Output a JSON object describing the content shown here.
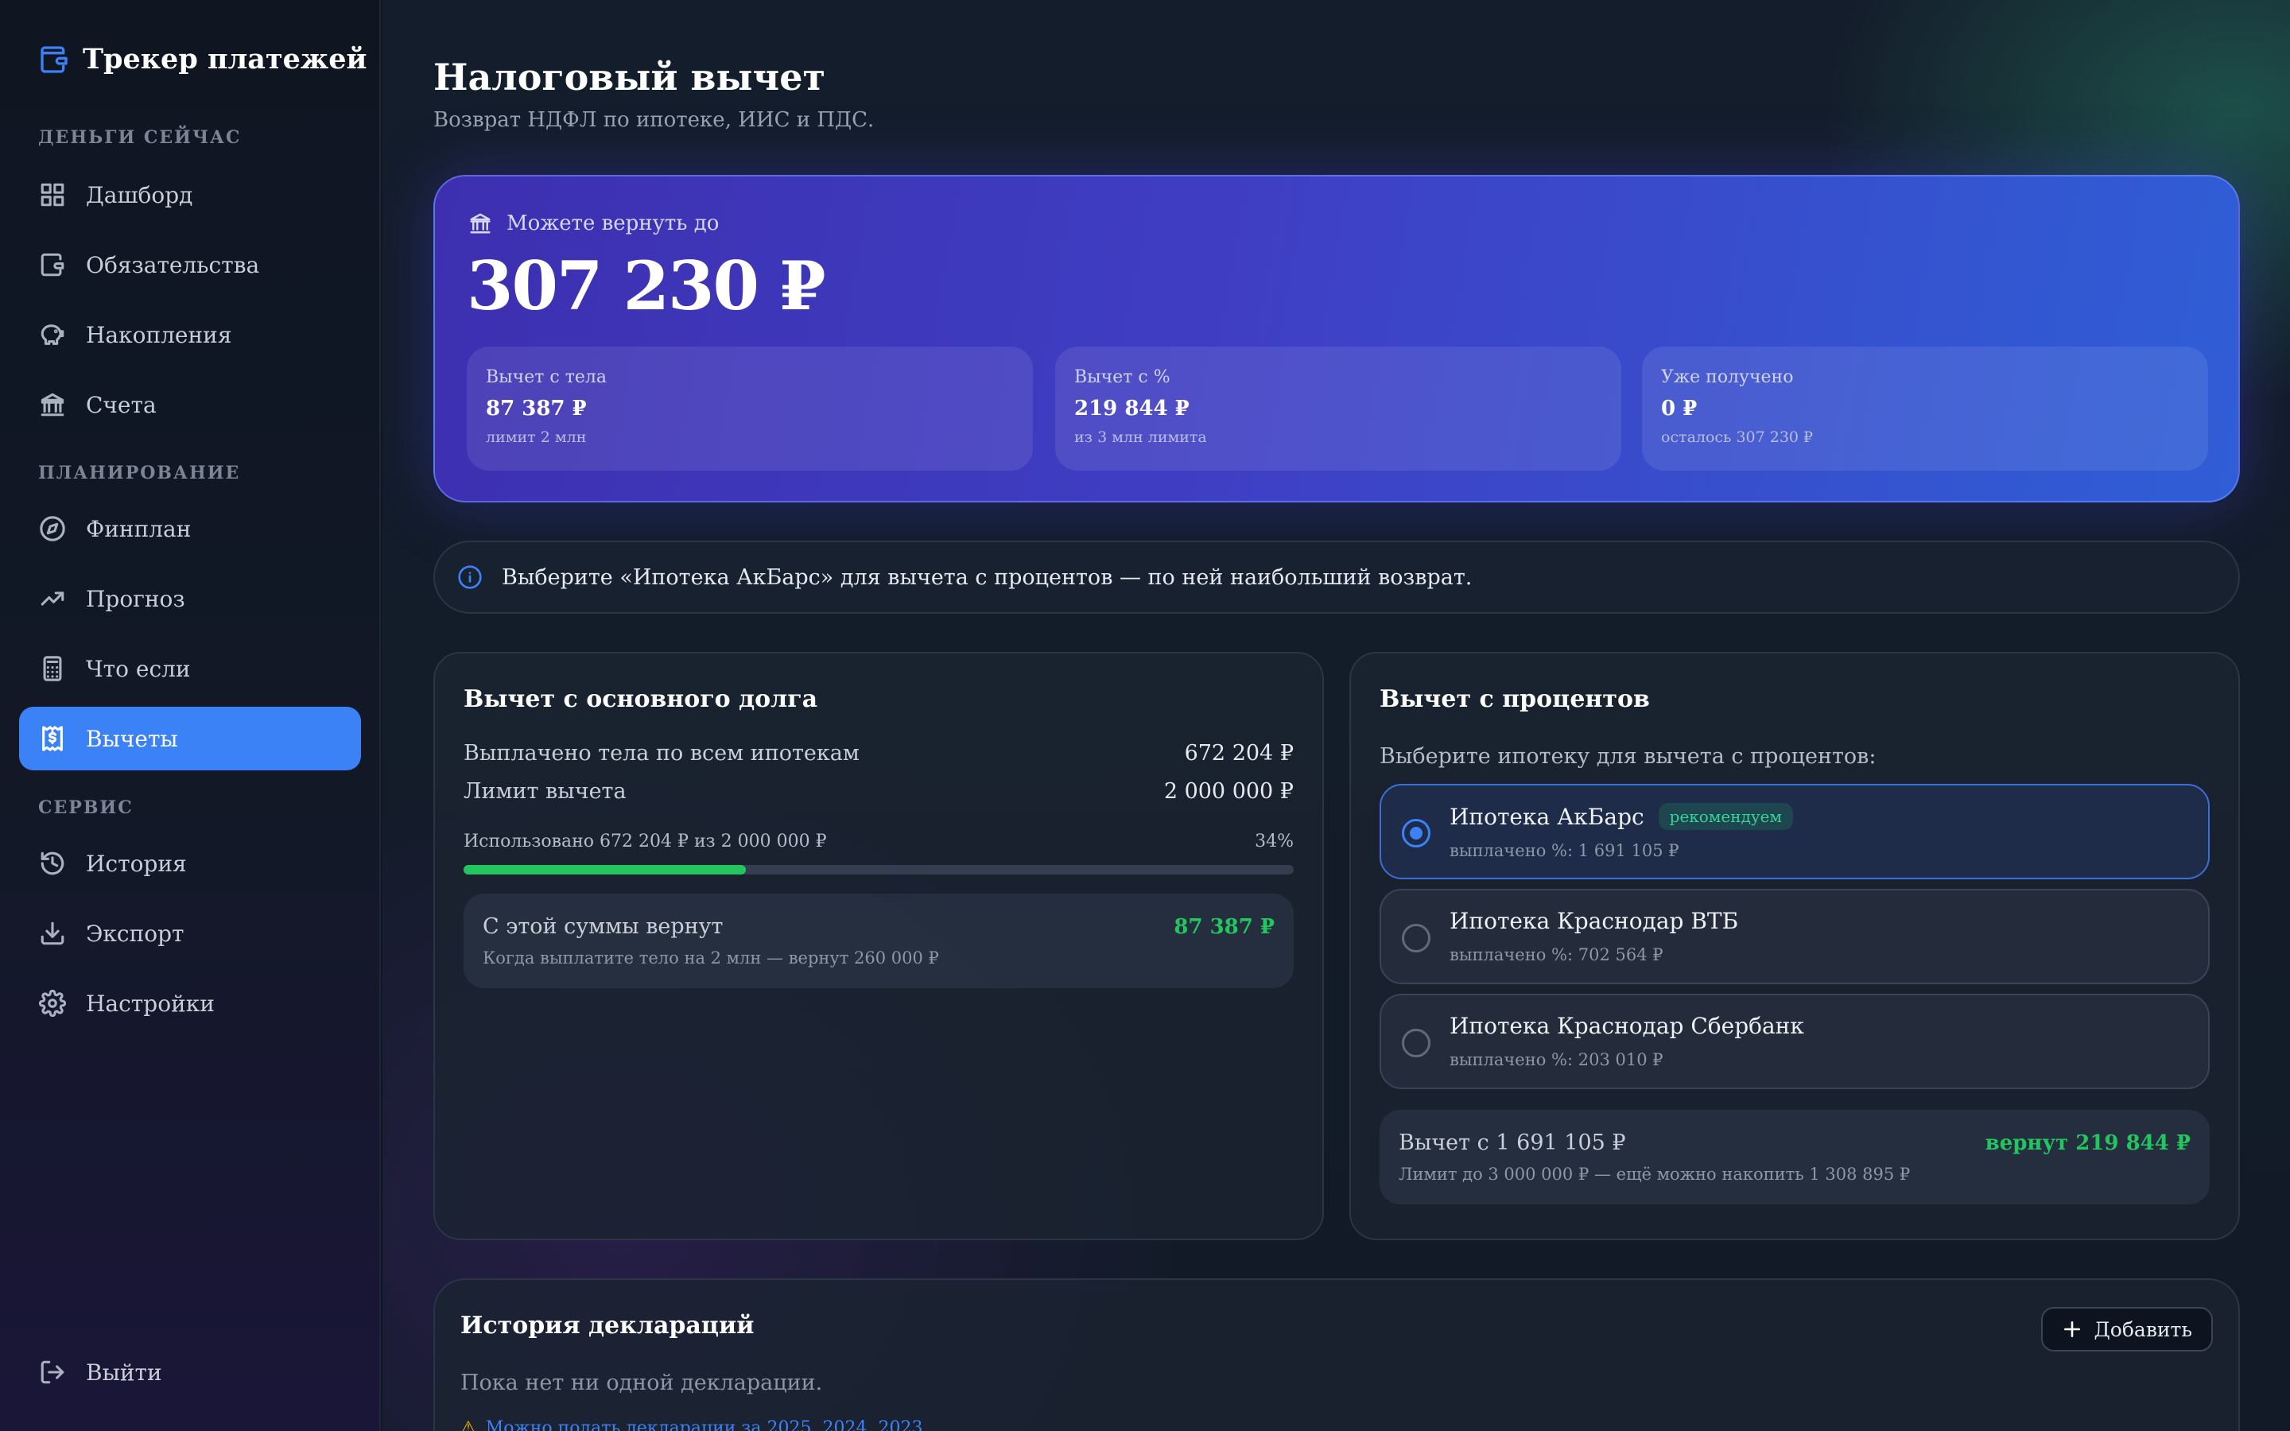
{
  "app": {
    "title": "Трекер платежей"
  },
  "sidebar": {
    "sections": [
      {
        "title": "ДЕНЬГИ СЕЙЧАС"
      },
      {
        "title": "ПЛАНИРОВАНИЕ"
      },
      {
        "title": "СЕРВИС"
      }
    ],
    "items": [
      {
        "label": "Дашборд",
        "icon": "dashboard-icon"
      },
      {
        "label": "Обязательства",
        "icon": "wallet-icon"
      },
      {
        "label": "Накопления",
        "icon": "piggy-bank-icon"
      },
      {
        "label": "Счета",
        "icon": "bank-icon"
      },
      {
        "label": "Финплан",
        "icon": "compass-icon"
      },
      {
        "label": "Прогноз",
        "icon": "trending-up-icon"
      },
      {
        "label": "Что если",
        "icon": "calculator-icon"
      },
      {
        "label": "Вычеты",
        "icon": "receipt-icon",
        "active": true
      },
      {
        "label": "История",
        "icon": "history-icon"
      },
      {
        "label": "Экспорт",
        "icon": "download-icon"
      },
      {
        "label": "Настройки",
        "icon": "gear-icon"
      }
    ],
    "logout": {
      "label": "Выйти",
      "icon": "logout-icon"
    }
  },
  "page": {
    "title": "Налоговый вычет",
    "subtitle": "Возврат НДФЛ по ипотеке, ИИС и ПДС."
  },
  "hero": {
    "label": "Можете вернуть до",
    "amount": "307 230 ₽",
    "cards": [
      {
        "label": "Вычет с тела",
        "value": "87 387 ₽",
        "note": "лимит 2 млн"
      },
      {
        "label": "Вычет с %",
        "value": "219 844 ₽",
        "note": "из 3 млн лимита"
      },
      {
        "label": "Уже получено",
        "value": "0 ₽",
        "note": "осталось 307 230 ₽"
      }
    ]
  },
  "info": {
    "text": "Выберите «Ипотека АкБарс» для вычета с процентов — по ней наибольший возврат."
  },
  "principal": {
    "title": "Вычет с основного долга",
    "rows": [
      {
        "label": "Выплачено тела по всем ипотекам",
        "value": "672 204 ₽"
      },
      {
        "label": "Лимит вычета",
        "value": "2 000 000 ₽"
      }
    ],
    "progress_label": "Использовано 672 204 ₽ из 2 000 000 ₽",
    "progress_percent_text": "34%",
    "progress_fraction": 0.34,
    "result_label": "С этой суммы вернут",
    "result_value": "87 387 ₽",
    "result_note": "Когда выплатите тело на 2 млн — вернут 260 000 ₽"
  },
  "interest": {
    "title": "Вычет с процентов",
    "choose_label": "Выберите ипотеку для вычета с процентов:",
    "options": [
      {
        "name": "Ипотека АкБарс",
        "badge": "рекомендуем",
        "note": "выплачено %: 1 691 105 ₽",
        "selected": true
      },
      {
        "name": "Ипотека Краснодар ВТБ",
        "note": "выплачено %: 702 564 ₽",
        "selected": false
      },
      {
        "name": "Ипотека Краснодар Сбербанк",
        "note": "выплачено %: 203 010 ₽",
        "selected": false
      }
    ],
    "result_label": "Вычет с 1 691 105 ₽",
    "result_value": "вернут 219 844 ₽",
    "result_note": "Лимит до 3 000 000 ₽ — ещё можно накопить 1 308 895 ₽"
  },
  "history": {
    "title": "История деклараций",
    "add_label": "Добавить",
    "empty_text": "Пока нет ни одной декларации.",
    "warning_text": "Можно подать декларации за 2025, 2024, 2023"
  },
  "colors": {
    "accent": "#3b82f6",
    "positive": "#22c55e",
    "hero_start": "#3d2fb0",
    "hero_end": "#2f5ed6"
  }
}
